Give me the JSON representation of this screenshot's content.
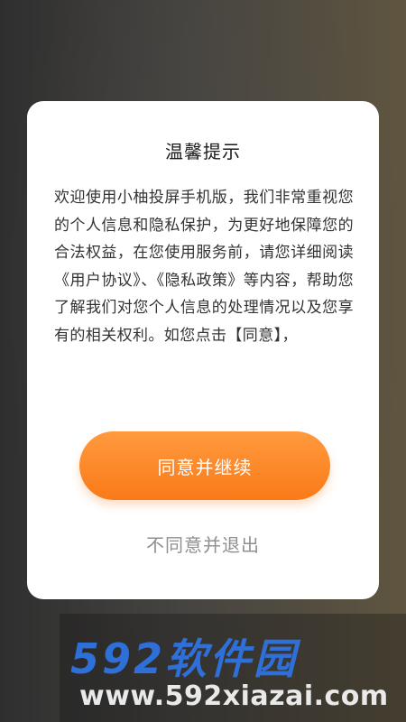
{
  "dialog": {
    "title": "温馨提示",
    "body": "欢迎使用小柚投屏手机版，我们非常重视您的个人信息和隐私保护，为更好地保障您的合法权益，在您使用服务前，请您详细阅读《用户协议》、《隐私政策》等内容，帮助您了解我们对您个人信息的处理情况以及您享有的相关权利。如您点击【同意】，",
    "agree_label": "同意并继续",
    "decline_label": "不同意并退出"
  },
  "watermark": {
    "logo_text": "592软件园",
    "url": "www.592xiazai.com"
  },
  "colors": {
    "accent": "#fa7a18",
    "accent_light": "#ff9a3e",
    "decline_text": "#8f8f8f",
    "watermark_blue": "#2f6fd8"
  }
}
